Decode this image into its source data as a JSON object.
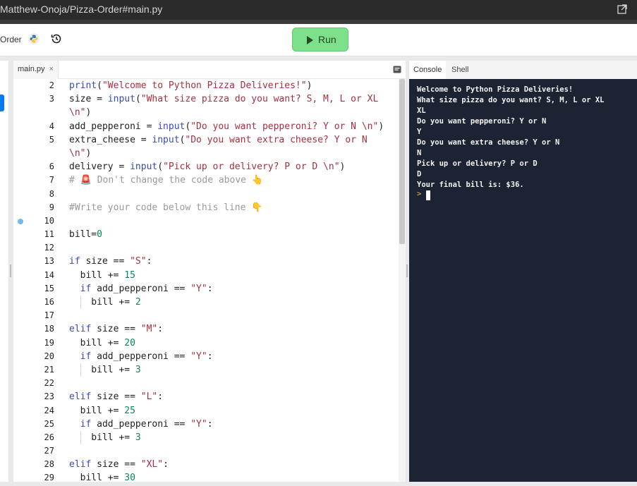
{
  "browser": {
    "url": "Matthew-Onoja/Pizza-Order#main.py"
  },
  "toolbar": {
    "repl_name": "Order",
    "run_label": "Run"
  },
  "icons": {
    "python": "python-logo-icon",
    "history": "history-icon",
    "external": "open-external-icon",
    "panel": "panel-toggle-icon"
  },
  "colors": {
    "run_button": "#7ee08a",
    "console_bg": "#1c2333",
    "accent": "#0079f2"
  },
  "editor": {
    "tab": {
      "label": "main.py",
      "close": "×"
    },
    "lines": [
      {
        "num": "2",
        "tokens": [
          [
            "b",
            "print"
          ],
          [
            "",
            "("
          ],
          [
            "s",
            "\"Welcome to Python Pizza Deliveries!\""
          ],
          [
            "",
            ")"
          ]
        ]
      },
      {
        "num": "3",
        "tokens": [
          [
            "",
            "size = "
          ],
          [
            "b",
            "input"
          ],
          [
            "",
            "("
          ],
          [
            "s",
            "\"What size pizza do you want? S, M, L or XL"
          ]
        ]
      },
      {
        "num": "",
        "tokens": [
          [
            "s",
            "\\n\""
          ],
          [
            "",
            ")"
          ]
        ]
      },
      {
        "num": "4",
        "tokens": [
          [
            "",
            "add_pepperoni = "
          ],
          [
            "b",
            "input"
          ],
          [
            "",
            "("
          ],
          [
            "s",
            "\"Do you want pepperoni? Y or N \\n\""
          ],
          [
            "",
            ")"
          ]
        ]
      },
      {
        "num": "5",
        "tokens": [
          [
            "",
            "extra_cheese = "
          ],
          [
            "b",
            "input"
          ],
          [
            "",
            "("
          ],
          [
            "s",
            "\"Do you want extra cheese? Y or N"
          ]
        ]
      },
      {
        "num": "",
        "tokens": [
          [
            "s",
            "\\n\""
          ],
          [
            "",
            ")"
          ]
        ]
      },
      {
        "num": "6",
        "tokens": [
          [
            "",
            "delivery = "
          ],
          [
            "b",
            "input"
          ],
          [
            "",
            "("
          ],
          [
            "s",
            "\"Pick up or delivery? P or D \\n\""
          ],
          [
            "",
            ")"
          ]
        ]
      },
      {
        "num": "7",
        "tokens": [
          [
            "c",
            "# 🚨 Don't change the code above 👆"
          ]
        ]
      },
      {
        "num": "8",
        "tokens": []
      },
      {
        "num": "9",
        "tokens": [
          [
            "c",
            "#Write your code below this line 👇"
          ]
        ]
      },
      {
        "num": "10",
        "tokens": [],
        "dot": true
      },
      {
        "num": "11",
        "tokens": [
          [
            "",
            "bill="
          ],
          [
            "n",
            "0"
          ]
        ]
      },
      {
        "num": "12",
        "tokens": []
      },
      {
        "num": "13",
        "tokens": [
          [
            "k",
            "if"
          ],
          [
            "",
            " size == "
          ],
          [
            "s",
            "\"S\""
          ],
          [
            "",
            ":"
          ]
        ]
      },
      {
        "num": "14",
        "tokens": [
          [
            "",
            "  bill += "
          ],
          [
            "n",
            "15"
          ]
        ]
      },
      {
        "num": "15",
        "tokens": [
          [
            "",
            "  "
          ],
          [
            "k",
            "if"
          ],
          [
            "",
            " add_pepperoni == "
          ],
          [
            "s",
            "\"Y\""
          ],
          [
            "",
            ":"
          ]
        ]
      },
      {
        "num": "16",
        "tokens": [
          [
            "",
            "    bill += "
          ],
          [
            "n",
            "2"
          ]
        ],
        "guide": true
      },
      {
        "num": "17",
        "tokens": []
      },
      {
        "num": "18",
        "tokens": [
          [
            "k",
            "elif"
          ],
          [
            "",
            " size == "
          ],
          [
            "s",
            "\"M\""
          ],
          [
            "",
            ":"
          ]
        ]
      },
      {
        "num": "19",
        "tokens": [
          [
            "",
            "  bill += "
          ],
          [
            "n",
            "20"
          ]
        ]
      },
      {
        "num": "20",
        "tokens": [
          [
            "",
            "  "
          ],
          [
            "k",
            "if"
          ],
          [
            "",
            " add_pepperoni == "
          ],
          [
            "s",
            "\"Y\""
          ],
          [
            "",
            ":"
          ]
        ]
      },
      {
        "num": "21",
        "tokens": [
          [
            "",
            "    bill += "
          ],
          [
            "n",
            "3"
          ]
        ],
        "guide": true
      },
      {
        "num": "22",
        "tokens": []
      },
      {
        "num": "23",
        "tokens": [
          [
            "k",
            "elif"
          ],
          [
            "",
            " size == "
          ],
          [
            "s",
            "\"L\""
          ],
          [
            "",
            ":"
          ]
        ]
      },
      {
        "num": "24",
        "tokens": [
          [
            "",
            "  bill += "
          ],
          [
            "n",
            "25"
          ]
        ]
      },
      {
        "num": "25",
        "tokens": [
          [
            "",
            "  "
          ],
          [
            "k",
            "if"
          ],
          [
            "",
            " add_pepperoni == "
          ],
          [
            "s",
            "\"Y\""
          ],
          [
            "",
            ":"
          ]
        ]
      },
      {
        "num": "26",
        "tokens": [
          [
            "",
            "    bill += "
          ],
          [
            "n",
            "3"
          ]
        ],
        "guide": true
      },
      {
        "num": "27",
        "tokens": []
      },
      {
        "num": "28",
        "tokens": [
          [
            "k",
            "elif"
          ],
          [
            "",
            " size == "
          ],
          [
            "s",
            "\"XL\""
          ],
          [
            "",
            ":"
          ]
        ]
      },
      {
        "num": "29",
        "tokens": [
          [
            "",
            "  bill += "
          ],
          [
            "n",
            "30"
          ]
        ]
      }
    ]
  },
  "console": {
    "tabs": [
      "Console",
      "Shell"
    ],
    "lines": [
      "Welcome to Python Pizza Deliveries!",
      "What size pizza do you want? S, M, L or XL",
      "XL",
      "Do you want pepperoni? Y or N",
      "Y",
      "Do you want extra cheese? Y or N",
      "N",
      "Pick up or delivery? P or D",
      "D",
      "Your final bill is: $36."
    ],
    "prompt": ">"
  }
}
